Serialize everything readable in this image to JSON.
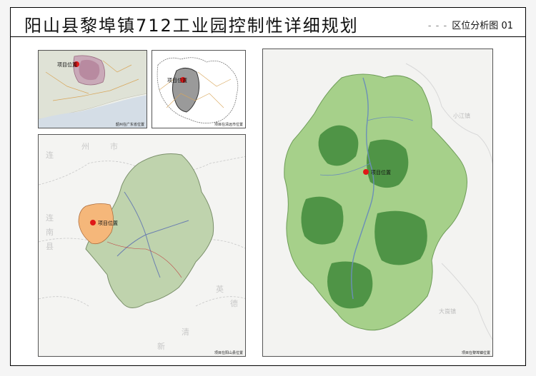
{
  "title": "阳山县黎埠镇712工业园控制性详细规划",
  "subtitle": {
    "dashes": "- - -",
    "label": "区位分析图",
    "number": "01"
  },
  "panels": {
    "province": {
      "caption": "韶州在广东省位置",
      "pin_label": "项目位置"
    },
    "city": {
      "caption": "项目在清远市位置",
      "pin_label": "项目位置"
    },
    "county": {
      "caption": "项目在阳山县位置",
      "pin_label": "项目位置",
      "place_chars": [
        "连",
        "州",
        "市",
        "连",
        "南",
        "县",
        "英",
        "德",
        "清",
        "新"
      ]
    },
    "town": {
      "caption": "项目在黎埠镇位置",
      "pin_label": "项目位置",
      "place_chars": [
        "小江镇",
        "大崀镇"
      ]
    }
  },
  "colors": {
    "pin": "#e01818",
    "highlight_county": "#f5b77a",
    "town_green": "#9cce7c",
    "forest": "#3f8a3a",
    "county_green": "#b7cfa2"
  }
}
